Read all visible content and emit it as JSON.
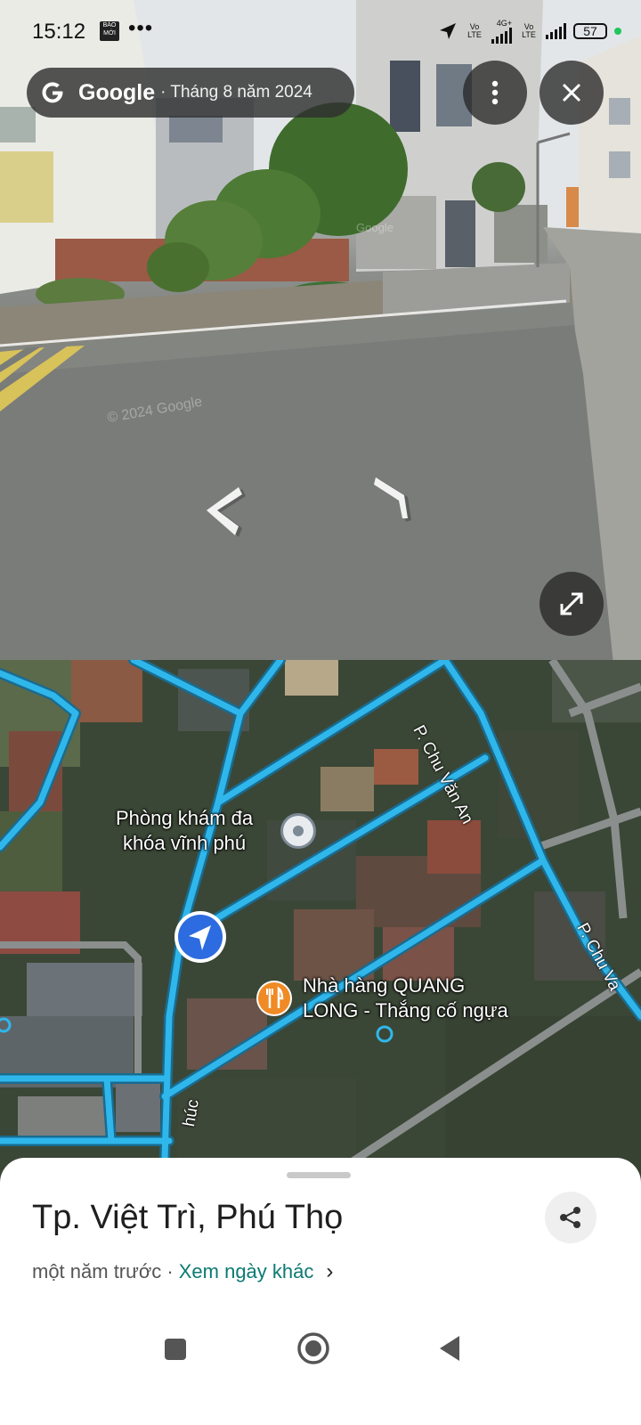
{
  "status_bar": {
    "time": "15:12",
    "news_badge": "BÁO MỚI",
    "overflow": "•••",
    "sim1": "Vo LTE",
    "network": "4G+",
    "sim2": "Vo LTE",
    "battery": "57"
  },
  "streetview": {
    "brand": "Google",
    "capture_date": "· Tháng 8 năm 2024",
    "watermark": "© 2024 Google",
    "watermark_small": "Google",
    "icons": {
      "more": "more-vert-icon",
      "close": "close-icon",
      "expand": "expand-icon",
      "left_arrow": "chevron-left-icon",
      "right_arrow": "chevron-right-icon"
    }
  },
  "map": {
    "poi": [
      {
        "name_line1": "Phòng khám đa",
        "name_line2": "khóa vĩnh phú",
        "icon": "pin-icon"
      },
      {
        "name_line1": "Nhà hàng QUANG",
        "name_line2": "LONG - Thắng cố ngựa",
        "icon": "restaurant-icon"
      }
    ],
    "streets": [
      "P. Chu Văn An",
      "P. Chu Va",
      "húc"
    ],
    "route_color": "#2fb7ec",
    "accent_blue": "#2d6be0",
    "restaurant_color": "#f08a24"
  },
  "sheet": {
    "title": "Tp. Việt Trì, Phú Thọ",
    "relative_time": "một năm trước ·",
    "other_dates_link": "Xem ngày khác",
    "chevron": "›",
    "link_color": "#0b7a72"
  },
  "system_nav": {
    "recents": "recents-button",
    "home": "home-button",
    "back": "back-button"
  }
}
